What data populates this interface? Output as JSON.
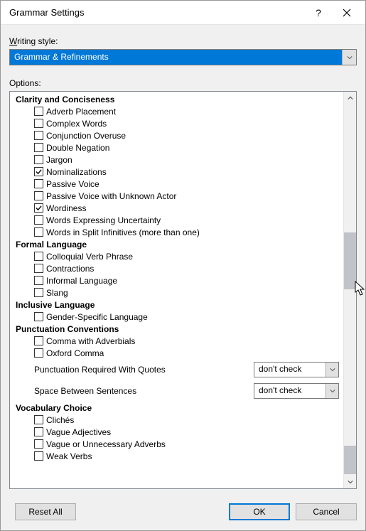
{
  "dialog_title": "Grammar Settings",
  "writing_style_label_pre": "W",
  "writing_style_label_rest": "riting style:",
  "writing_style_value": "Grammar & Refinements",
  "options_label": "Options:",
  "groups": [
    {
      "head": "Clarity and Conciseness",
      "items": [
        {
          "label": "Adverb Placement",
          "checked": false
        },
        {
          "label": "Complex Words",
          "checked": false
        },
        {
          "label": "Conjunction Overuse",
          "checked": false
        },
        {
          "label": "Double Negation",
          "checked": false
        },
        {
          "label": "Jargon",
          "checked": false
        },
        {
          "label": "Nominalizations",
          "checked": true
        },
        {
          "label": "Passive Voice",
          "checked": false
        },
        {
          "label": "Passive Voice with Unknown Actor",
          "checked": false
        },
        {
          "label": "Wordiness",
          "checked": true
        },
        {
          "label": "Words Expressing Uncertainty",
          "checked": false
        },
        {
          "label": "Words in Split Infinitives (more than one)",
          "checked": false
        }
      ]
    },
    {
      "head": "Formal Language",
      "items": [
        {
          "label": "Colloquial Verb Phrase",
          "checked": false
        },
        {
          "label": "Contractions",
          "checked": false
        },
        {
          "label": "Informal Language",
          "checked": false
        },
        {
          "label": "Slang",
          "checked": false
        }
      ]
    },
    {
      "head": "Inclusive Language",
      "items": [
        {
          "label": "Gender-Specific Language",
          "checked": false
        }
      ]
    },
    {
      "head": "Punctuation Conventions",
      "items": [
        {
          "label": "Comma with Adverbials",
          "checked": false
        },
        {
          "label": "Oxford Comma",
          "checked": false
        }
      ],
      "dropdowns": [
        {
          "label": "Punctuation Required With Quotes",
          "value": "don't check"
        },
        {
          "label": "Space Between Sentences",
          "value": "don't check"
        }
      ]
    },
    {
      "head": "Vocabulary Choice",
      "items": [
        {
          "label": "Clichés",
          "checked": false
        },
        {
          "label": "Vague Adjectives",
          "checked": false
        },
        {
          "label": "Vague or Unnecessary Adverbs",
          "checked": false
        },
        {
          "label": "Weak Verbs",
          "checked": false
        }
      ]
    }
  ],
  "buttons": {
    "reset": "Reset All",
    "ok": "OK",
    "cancel": "Cancel"
  }
}
